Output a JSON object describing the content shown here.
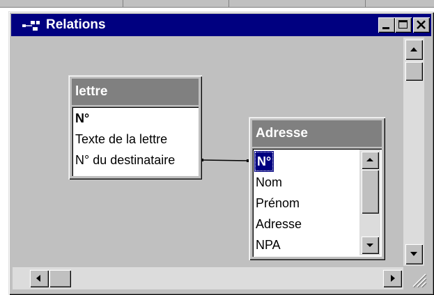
{
  "window": {
    "title": "Relations"
  },
  "tables": [
    {
      "name": "lettre",
      "fields": [
        "N°",
        "Texte de la lettre",
        "N° du destinataire"
      ]
    },
    {
      "name": "Adresse",
      "fields": [
        "N°",
        "Nom",
        "Prénom",
        "Adresse",
        "NPA"
      ]
    }
  ],
  "icons": {
    "app": "relations-icon",
    "minimize": "minimize-icon",
    "maximize": "maximize-icon",
    "close": "close-icon"
  },
  "colors": {
    "titlebar": "#000080",
    "table_header": "#808080",
    "selection": "#000080",
    "face": "#c0c0c0"
  }
}
